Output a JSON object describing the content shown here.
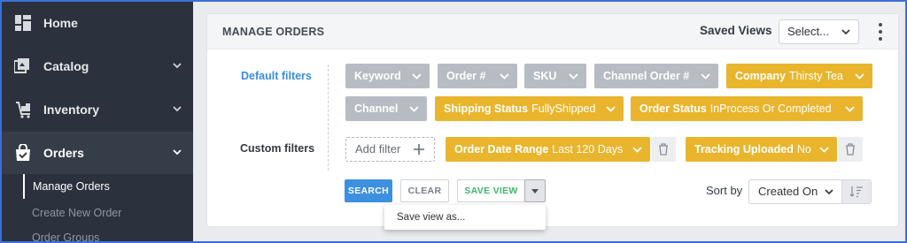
{
  "sidebar": {
    "items": [
      {
        "label": "Home",
        "icon": "dashboard-icon"
      },
      {
        "label": "Catalog",
        "icon": "catalog-icon"
      },
      {
        "label": "Inventory",
        "icon": "inventory-icon"
      },
      {
        "label": "Orders",
        "icon": "orders-icon"
      }
    ],
    "sub_items": [
      {
        "label": "Manage Orders"
      },
      {
        "label": "Create New Order"
      },
      {
        "label": "Order Groups"
      }
    ]
  },
  "header": {
    "title": "MANAGE ORDERS",
    "saved_views_label": "Saved Views",
    "saved_views_value": "Select..."
  },
  "filters": {
    "default_label": "Default filters",
    "custom_label": "Custom filters",
    "default_chips": [
      {
        "label": "Keyword",
        "value": ""
      },
      {
        "label": "Order #",
        "value": ""
      },
      {
        "label": "SKU",
        "value": ""
      },
      {
        "label": "Channel Order #",
        "value": ""
      },
      {
        "label": "Company",
        "value": "Thirsty Tea"
      },
      {
        "label": "Channel",
        "value": ""
      },
      {
        "label": "Shipping Status",
        "value": "FullyShipped"
      },
      {
        "label": "Order Status",
        "value": "InProcess Or Completed"
      }
    ],
    "add_filter_label": "Add filter",
    "custom_chips": [
      {
        "label": "Order Date Range",
        "value": "Last 120 Days"
      },
      {
        "label": "Tracking Uploaded",
        "value": "No"
      }
    ]
  },
  "actions": {
    "search_label": "SEARCH",
    "clear_label": "CLEAR",
    "save_view_label": "SAVE VIEW",
    "save_view_menu_item": "Save view as...",
    "sort_by_label": "Sort by",
    "sort_by_value": "Created On"
  },
  "colors": {
    "sidebar_bg": "#2b323d",
    "accent_blue": "#3d8fe0",
    "chip_gold": "#e9b52d",
    "chip_gray": "#b7bcc3",
    "save_green": "#3cb66b"
  }
}
